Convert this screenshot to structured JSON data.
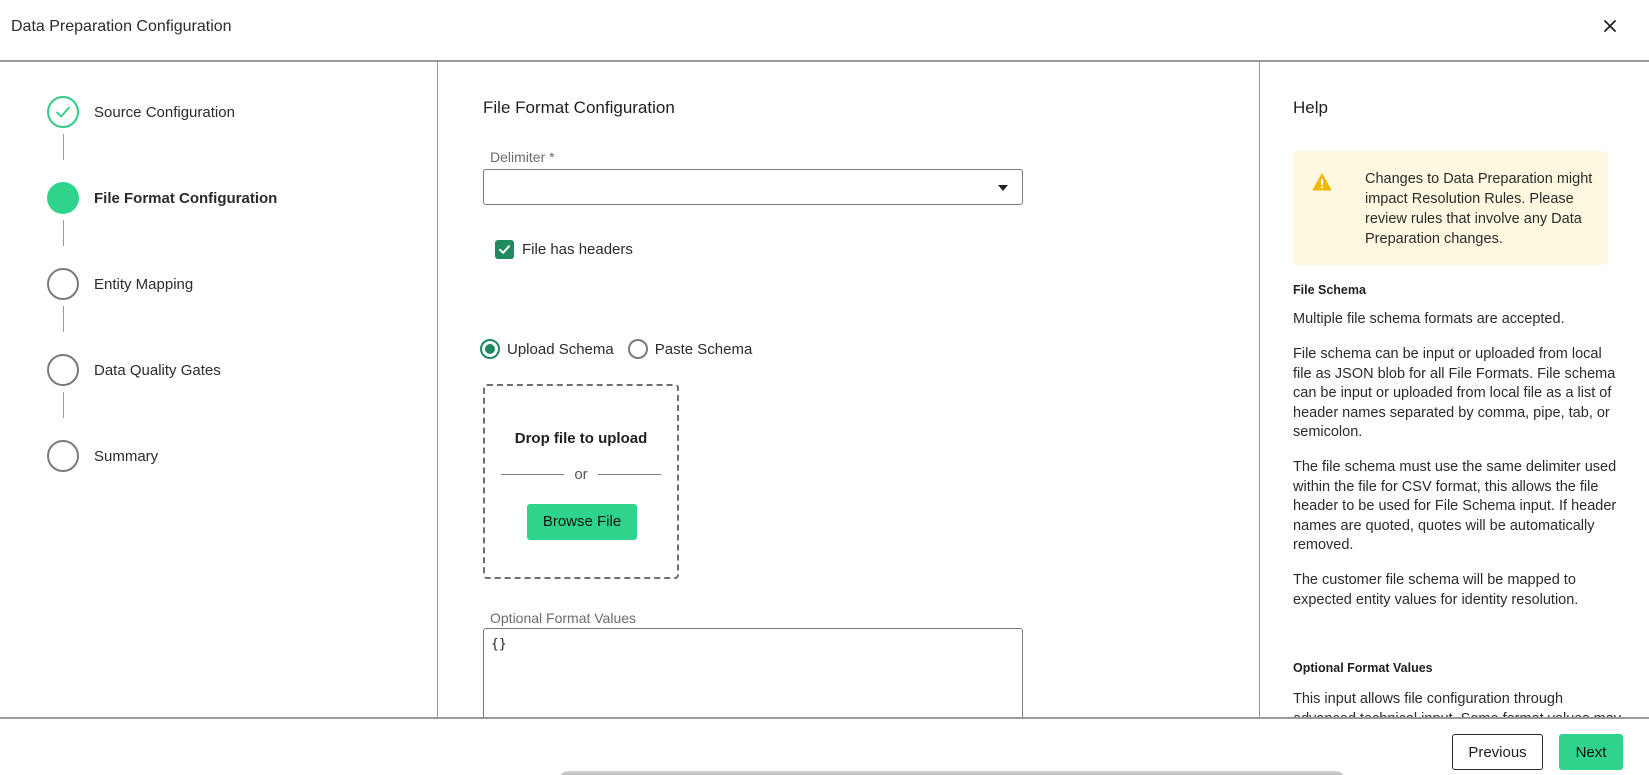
{
  "header": {
    "title": "Data Preparation Configuration",
    "close_icon": "close-icon"
  },
  "stepper": {
    "steps": [
      {
        "label": "Source Configuration",
        "state": "complete"
      },
      {
        "label": "File Format Configuration",
        "state": "active"
      },
      {
        "label": "Entity Mapping",
        "state": "pending"
      },
      {
        "label": "Data Quality Gates",
        "state": "pending"
      },
      {
        "label": "Summary",
        "state": "pending"
      }
    ]
  },
  "main": {
    "title": "File Format Configuration",
    "delimiter": {
      "label": "Delimiter",
      "required_marker": "*",
      "value": ""
    },
    "file_has_headers": {
      "label": "File has headers",
      "checked": true
    },
    "schema_mode": {
      "options": [
        {
          "label": "Upload Schema",
          "selected": true
        },
        {
          "label": "Paste Schema",
          "selected": false
        }
      ]
    },
    "dropzone": {
      "title": "Drop file to upload",
      "or_text": "or",
      "browse_label": "Browse File"
    },
    "optional_format_values": {
      "label": "Optional Format Values",
      "value": "{}"
    }
  },
  "help": {
    "title": "Help",
    "warning": {
      "icon": "warning-icon",
      "text": "Changes to Data Preparation might impact Resolution Rules. Please review rules that involve any Data Preparation changes."
    },
    "file_schema_heading": "File Schema",
    "file_schema_paragraphs": [
      "Multiple file schema formats are accepted.",
      "File schema can be input or uploaded from local file as JSON blob for all File Formats. File schema can be input or uploaded from local file as a list of header names separated by comma, pipe, tab, or semicolon.",
      "The file schema must use the same delimiter used within the file for CSV format, this allows the file header to be used for File Schema input. If header names are quoted, quotes will be automatically removed.",
      "The customer file schema will be mapped to expected entity values for identity resolution."
    ],
    "optional_format_heading": "Optional Format Values",
    "optional_format_paragraph": "This input allows file configuration through advanced technical input. Some format values may"
  },
  "footer": {
    "previous_label": "Previous",
    "next_label": "Next"
  },
  "colors": {
    "accent": "#2fd48c",
    "accent_dark": "#1e8a5e",
    "warning_bg": "#fff8e1",
    "warning_icon": "#f2b705"
  }
}
